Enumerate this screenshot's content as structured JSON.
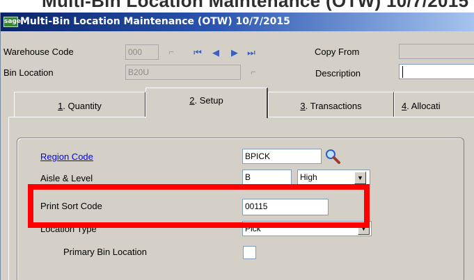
{
  "window": {
    "title": "Multi-Bin Location Maintenance (OTW) 10/7/2015",
    "logo_text": "sage"
  },
  "header": {
    "warehouse_code_label": "Warehouse Code",
    "warehouse_code_value": "000",
    "bin_location_label": "Bin Location",
    "bin_location_value": "B20U",
    "copy_from_label": "Copy From",
    "copy_from_value": "",
    "description_label": "Description",
    "description_value": ""
  },
  "nav_icons": [
    "first-record-icon",
    "previous-record-icon",
    "next-record-icon",
    "last-record-icon"
  ],
  "tabs": [
    {
      "key": "1",
      "label": ". Quantity"
    },
    {
      "key": "2",
      "label": ". Setup"
    },
    {
      "key": "3",
      "label": ". Transactions"
    },
    {
      "key": "4",
      "label": ". Allocati"
    }
  ],
  "setup": {
    "region_code_label": "Region Code",
    "region_code_value": "BPICK",
    "aisle_level_label": "Aisle & Level",
    "aisle_value": "B",
    "level_value": "High",
    "print_sort_code_label": "Print Sort Code",
    "print_sort_code_value": "00115",
    "location_type_label": "Location Type",
    "location_type_value": "Pick",
    "primary_bin_label": "Primary Bin Location"
  },
  "colors": {
    "highlight": "#ff0000",
    "titlebar_start": "#0a246a",
    "titlebar_end": "#a6c4ee",
    "link": "#0000ff"
  }
}
